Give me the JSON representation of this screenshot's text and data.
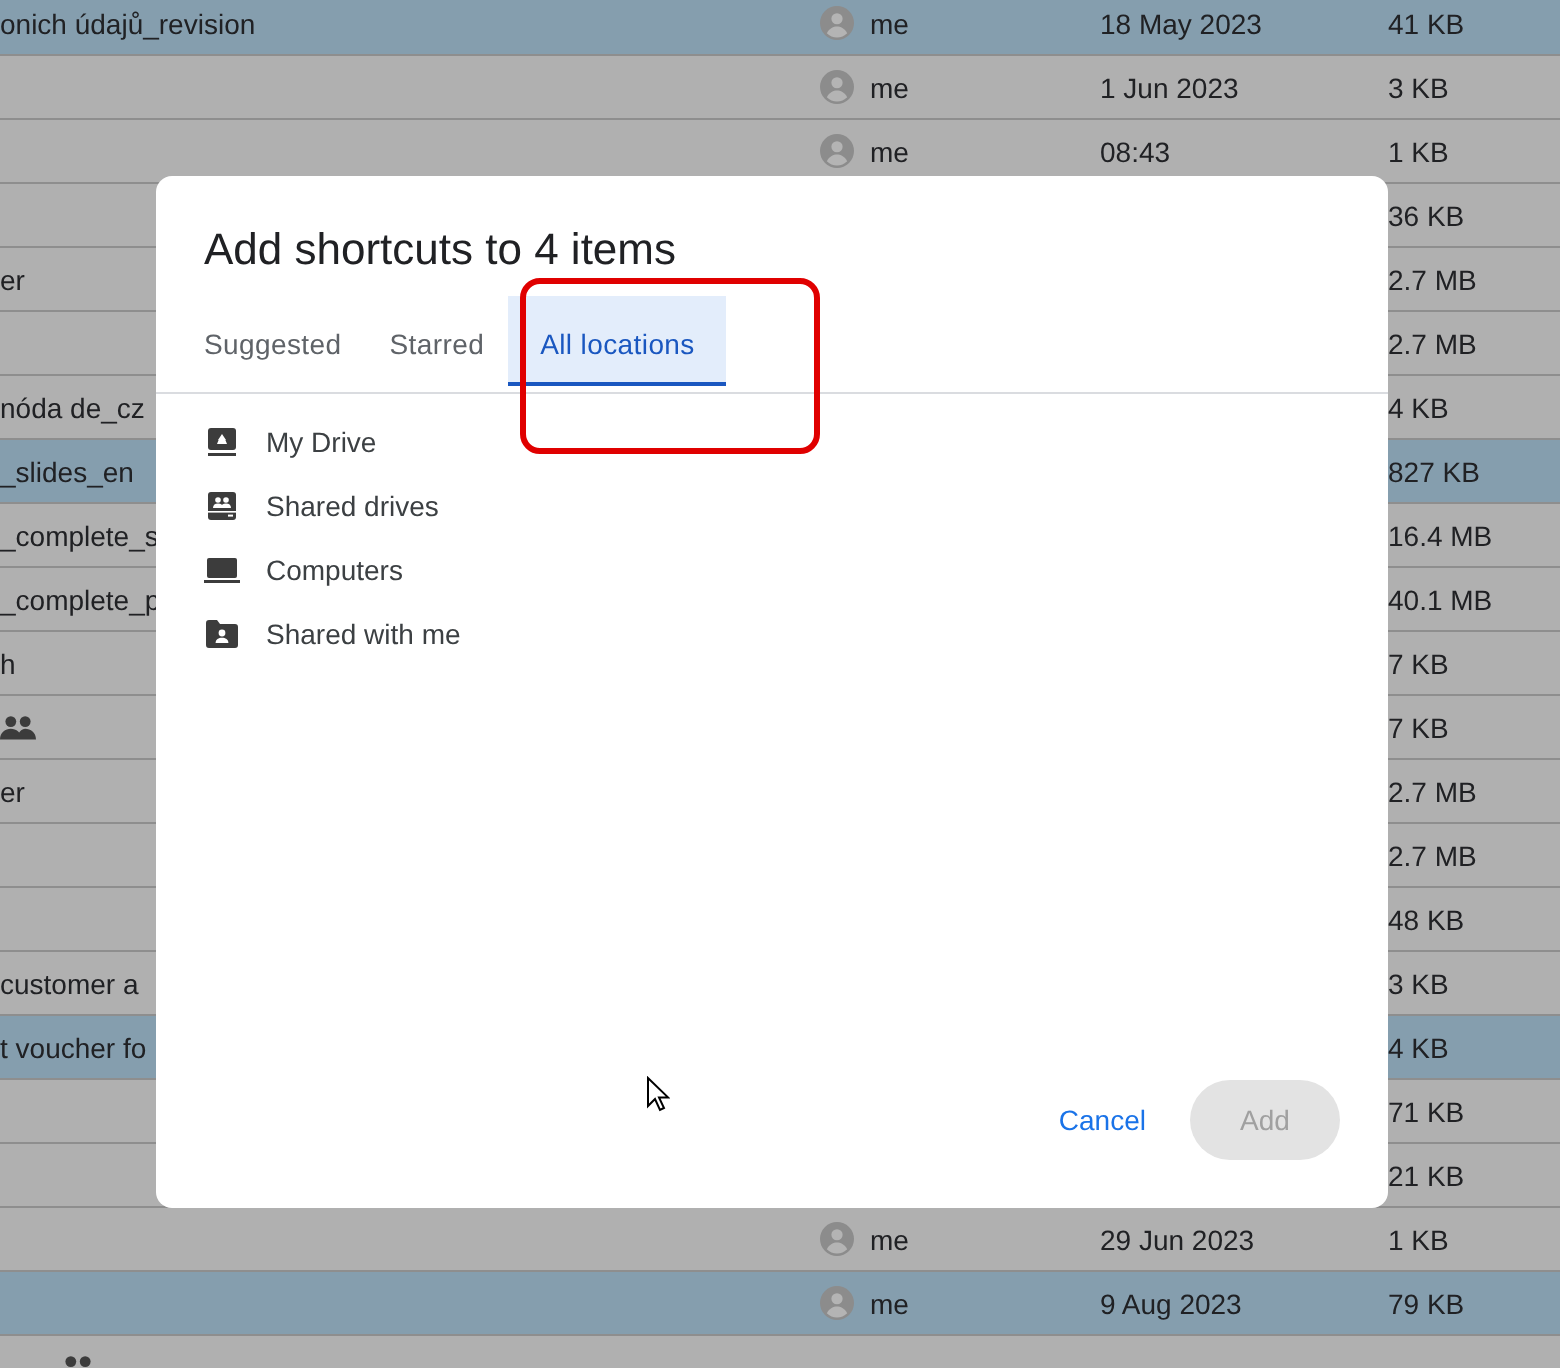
{
  "file_list": {
    "rows": [
      {
        "name": "onich údajů_revision",
        "owner": "me",
        "modified": "18 May 2023",
        "size": "41 KB",
        "selected": true,
        "shared": false
      },
      {
        "owner": "me",
        "modified": "1 Jun 2023",
        "size": "3 KB",
        "selected": false,
        "shared": false
      },
      {
        "owner": "me",
        "modified": "08:43",
        "size": "1 KB",
        "selected": false,
        "shared": false
      },
      {
        "size": "36 KB",
        "selected": false,
        "shared": false
      },
      {
        "name": "er",
        "size": "2.7 MB",
        "selected": false,
        "shared": false
      },
      {
        "size": "2.7 MB",
        "selected": false,
        "shared": false
      },
      {
        "name": "nóda de_cz",
        "size": "4 KB",
        "selected": false,
        "shared": false
      },
      {
        "name": "_slides_en",
        "size": "827 KB",
        "selected": true,
        "shared": false
      },
      {
        "name": "_complete_s",
        "size": "16.4 MB",
        "selected": false,
        "shared": false
      },
      {
        "name": "_complete_p",
        "size": "40.1 MB",
        "selected": false,
        "shared": false
      },
      {
        "name": "h",
        "size": "7 KB",
        "selected": false,
        "shared": false
      },
      {
        "size": "7 KB",
        "selected": false,
        "shared": true
      },
      {
        "name": "er",
        "size": "2.7 MB",
        "selected": false,
        "shared": false
      },
      {
        "size": "2.7 MB",
        "selected": false,
        "shared": false
      },
      {
        "size": "48 KB",
        "selected": false,
        "shared": false
      },
      {
        "name": "customer a",
        "size": "3 KB",
        "selected": false,
        "shared": false
      },
      {
        "name": "t voucher fo",
        "size": "4 KB",
        "selected": true,
        "shared": false
      },
      {
        "size": "71 KB",
        "selected": false,
        "shared": false
      },
      {
        "size": "21 KB",
        "selected": false,
        "shared": false
      },
      {
        "owner": "me",
        "modified": "29 Jun 2023",
        "size": "1 KB",
        "selected": false,
        "shared": false
      },
      {
        "owner": "me",
        "modified": "9 Aug 2023",
        "size": "79 KB",
        "selected": true,
        "shared": false
      },
      {
        "selected": false,
        "shared": true
      }
    ]
  },
  "dialog": {
    "title": "Add shortcuts to 4 items",
    "tabs": [
      {
        "label": "Suggested",
        "selected": false
      },
      {
        "label": "Starred",
        "selected": false
      },
      {
        "label": "All locations",
        "selected": true
      }
    ],
    "locations": [
      {
        "kind": "my_drive",
        "label": "My Drive"
      },
      {
        "kind": "shared_drives",
        "label": "Shared drives"
      },
      {
        "kind": "computers",
        "label": "Computers"
      },
      {
        "kind": "shared_folder",
        "label": "Shared with me"
      }
    ],
    "buttons": {
      "cancel": "Cancel",
      "add": {
        "label": "Add",
        "disabled": true
      }
    }
  }
}
